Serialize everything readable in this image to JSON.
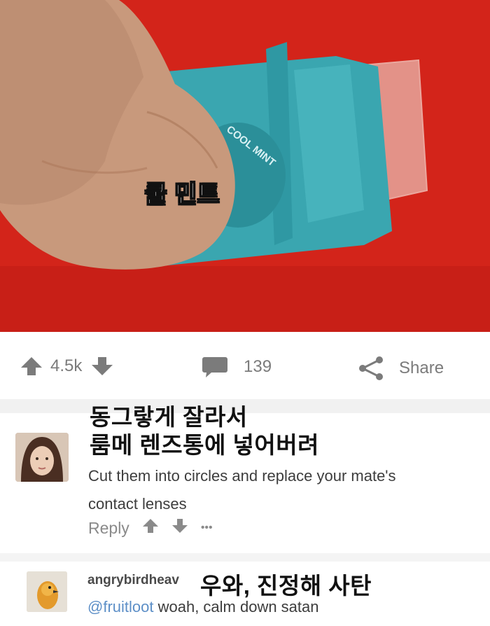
{
  "photo": {
    "overlay_caption": "쿨 민트",
    "case_text": "COOL MINT",
    "background_color": "#d3241a",
    "case_color": "#3aa6b0"
  },
  "action_bar": {
    "upvote_count": "4.5k",
    "comment_count": "139",
    "share_label": "Share"
  },
  "comment1": {
    "caption_line1": "동그랗게 잘라서",
    "caption_line2": "룸메 렌즈통에 넣어버려",
    "body_line1": "Cut them into circles and replace your mate's",
    "body_line2": "contact lenses",
    "reply_label": "Reply",
    "more_label": "•••"
  },
  "comment2": {
    "username": "angrybirdheav",
    "caption": "우와, 진정해 사탄",
    "mention": "@fruitloot",
    "body": " woah, calm down satan"
  }
}
